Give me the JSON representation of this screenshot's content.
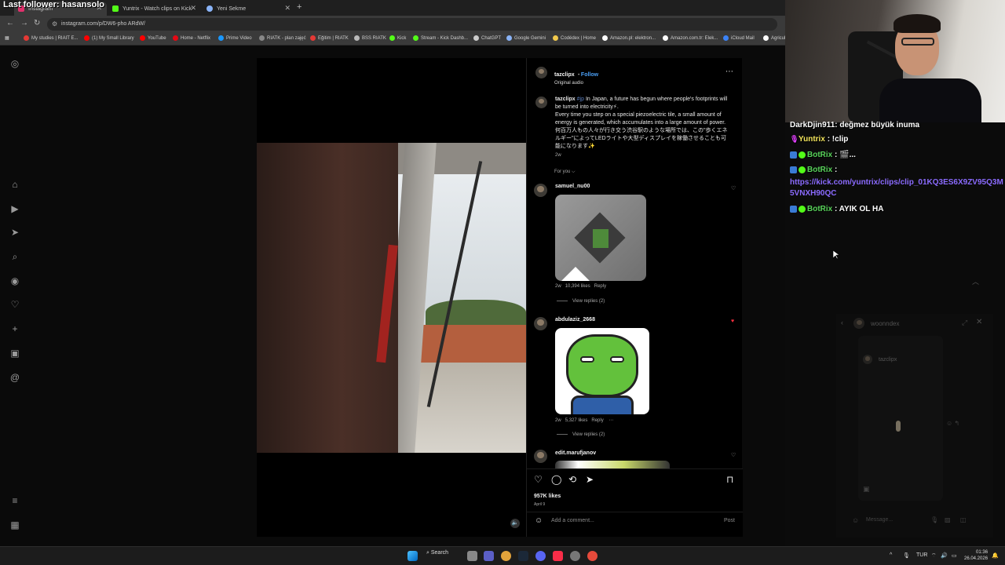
{
  "stream": {
    "overlay_title": "Last follower: hasansolo"
  },
  "browser": {
    "tabs": [
      {
        "label": "Instagram",
        "color": "#e1306c",
        "active": true
      },
      {
        "label": "Yuntrix - Watch clips on Kick",
        "color": "#53fc18",
        "active": false
      },
      {
        "label": "Yeni Sekme",
        "color": "#8ab4f8",
        "active": false
      }
    ],
    "url": "instagram.com/p/DW6-pho ARdW/",
    "bookmarks": [
      {
        "label": "My studies | RIAIT E...",
        "color": "#e53935"
      },
      {
        "label": "(1) My Small Library",
        "color": "#ff0000"
      },
      {
        "label": "YouTube",
        "color": "#ff0000"
      },
      {
        "label": "Home - Netflix",
        "color": "#e50914"
      },
      {
        "label": "Prime Video",
        "color": "#1a98ff"
      },
      {
        "label": "RIATK - plan zajęć",
        "color": "#888888"
      },
      {
        "label": "Eğitim | RIATK",
        "color": "#e53935"
      },
      {
        "label": "BSS RIATK",
        "color": "#bbbbbb"
      },
      {
        "label": "Kick",
        "color": "#53fc18"
      },
      {
        "label": "Stream - Kick Dashb...",
        "color": "#53fc18"
      },
      {
        "label": "ChatGPT",
        "color": "#cccccc"
      },
      {
        "label": "Google Gemini",
        "color": "#8ab4f8"
      },
      {
        "label": "Codédex | Home",
        "color": "#f2c94c"
      },
      {
        "label": "Amazon.pl: elektron...",
        "color": "#ffffff"
      },
      {
        "label": "Amazon.com.tr: Elek...",
        "color": "#ffffff"
      },
      {
        "label": "iCloud Mail",
        "color": "#3b82f6"
      },
      {
        "label": "Agricul",
        "color": "#ffffff"
      }
    ]
  },
  "post": {
    "author": "tazclipx",
    "follow_label": "Follow",
    "audio": "Original audio",
    "caption_user": "tazclipx",
    "caption_tag": "#jp",
    "caption_text": "In Japan, a future has begun where people's footprints will be turned into electricity⚡.",
    "caption_text2": "Every time you step on a special piezoelectric tile, a small amount of energy is generated, which accumulates into a large amount of power. 何百万人もの人々が行き交う渋谷駅のような場所では、この\"歩くエネルギー\"によってLEDライトや大型ディスプレイを稼働させることも可能になります✨",
    "caption_time": "2w",
    "for_you": "For you ⌵",
    "comments": [
      {
        "user": "samuel_nu00",
        "time": "2w",
        "likes": "10,394 likes",
        "reply": "Reply",
        "view_replies": "View replies (2)",
        "liked": false
      },
      {
        "user": "abdulaziz_2668",
        "time": "2w",
        "likes": "5,327 likes",
        "reply": "Reply",
        "view_replies": "View replies (2)",
        "liked": true
      },
      {
        "user": "edit.marufjanov",
        "liked": false
      }
    ],
    "likes_total": "957K likes",
    "date": "April 9",
    "comment_placeholder": "Add a comment...",
    "post_label": "Post"
  },
  "chat": {
    "lines": [
      {
        "user": "DarkDjin911",
        "text": ": değmez büyük inuma"
      },
      {
        "user": "Yuntrix",
        "text": ": !clip"
      },
      {
        "user": "BotRix",
        "text": ": 🎬..."
      },
      {
        "user": "BotRix",
        "text": ":"
      },
      {
        "user": "BotRix",
        "text": ": AYIK OL HA"
      }
    ],
    "link": "https://kick.com/yuntrix/clips/clip_01KQ3ES6X9ZV95Q3M5VNXH90QC"
  },
  "dm": {
    "username": "woonndex",
    "thread_user": "tazclipx",
    "placeholder": "Message..."
  },
  "taskbar": {
    "search_label": "Search",
    "lang": "TUR",
    "time": "01:36",
    "date": "26.04.2026"
  }
}
